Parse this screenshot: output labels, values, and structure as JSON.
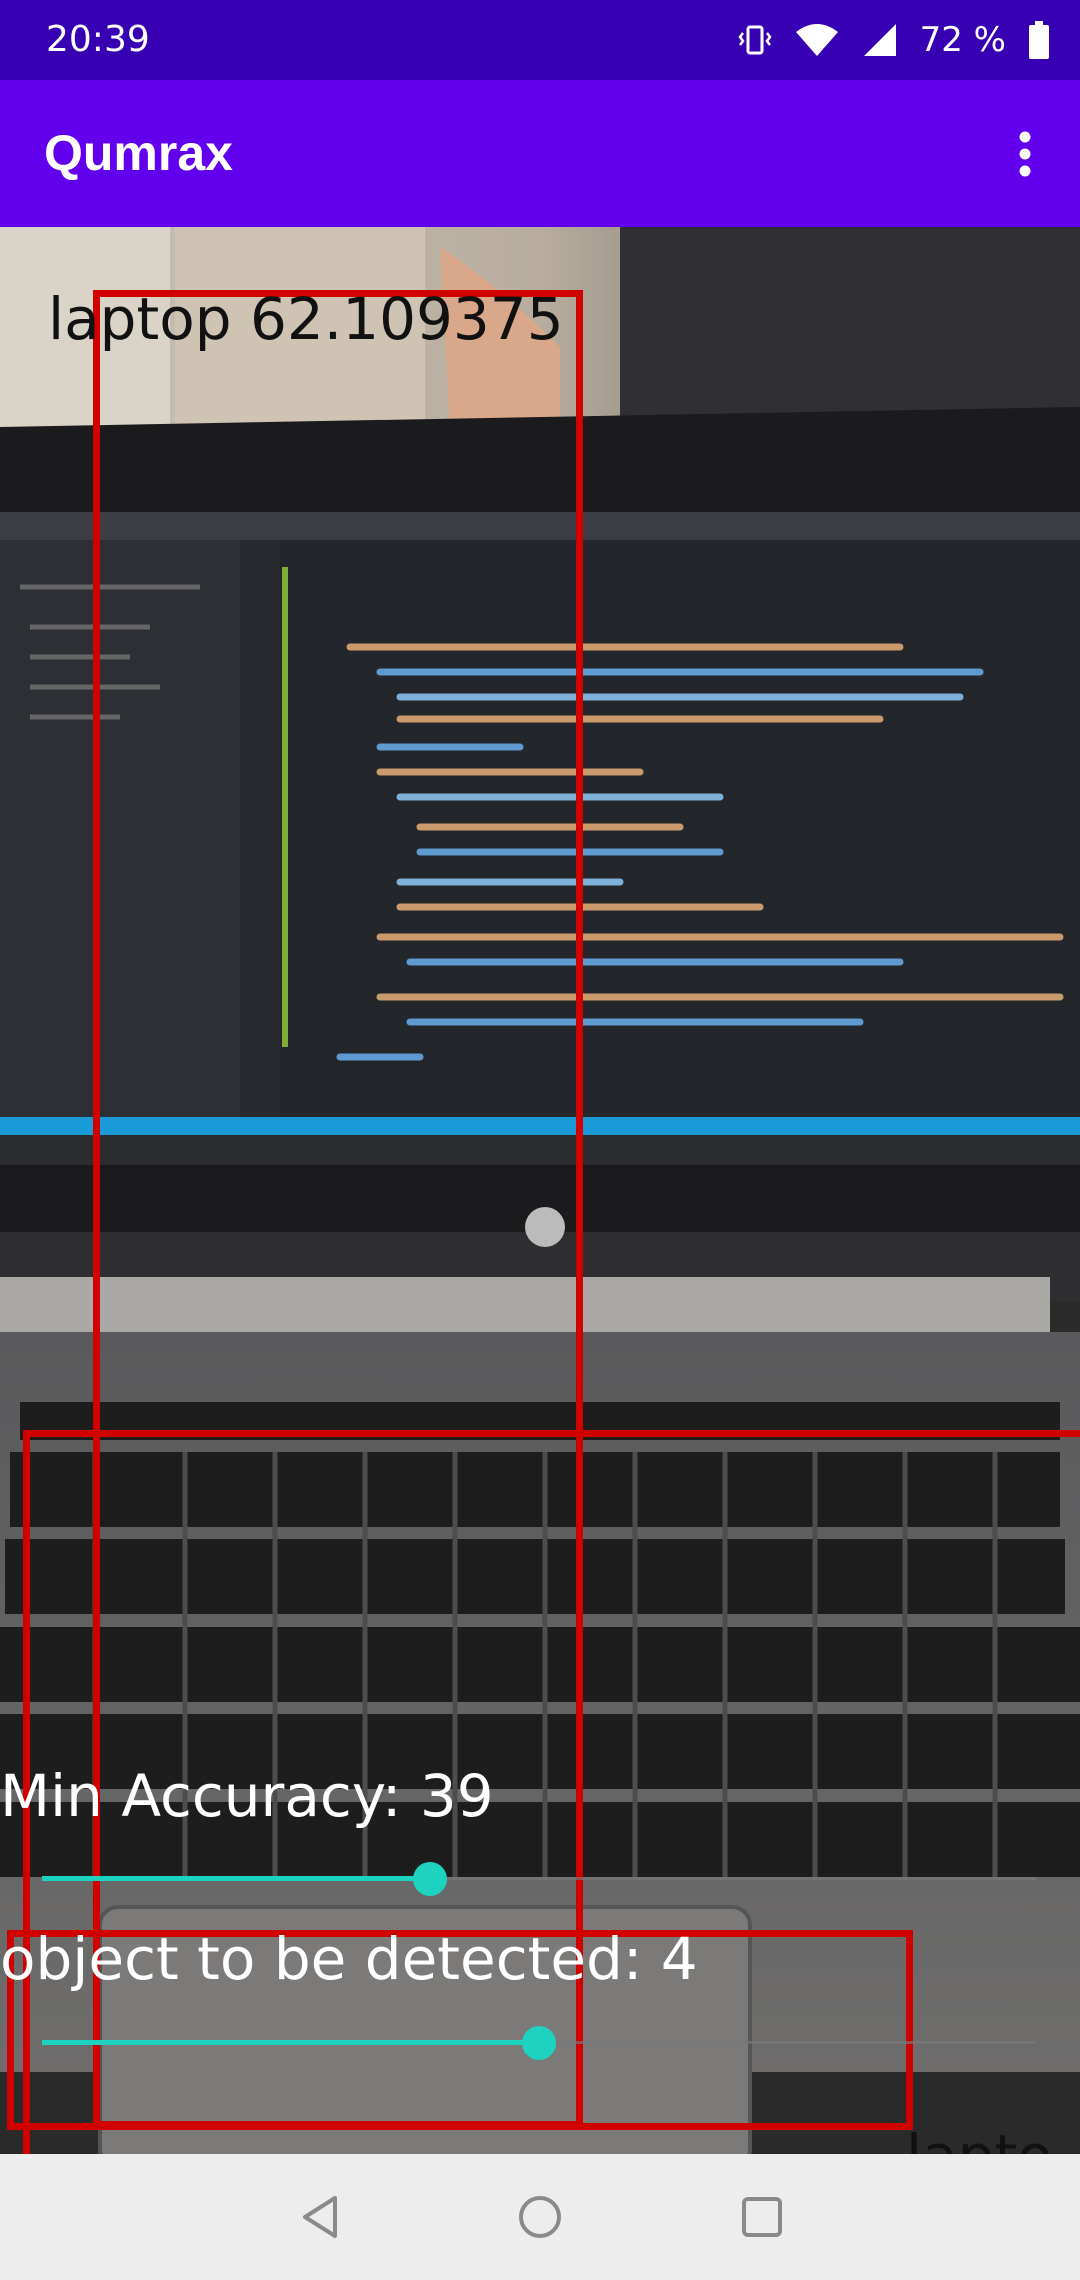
{
  "status_bar": {
    "time": "20:39",
    "battery_percent": "72 %",
    "icons": [
      "vibrate-icon",
      "wifi-icon",
      "signal-icon",
      "battery-icon"
    ]
  },
  "app_bar": {
    "title": "Qumrax",
    "menu_icon": "more-vert-icon"
  },
  "detections": [
    {
      "label": "laptop 62.109375"
    },
    {
      "label": ""
    },
    {
      "label": ""
    },
    {
      "label": "lapto"
    }
  ],
  "controls": {
    "min_accuracy": {
      "label": "Min Accuracy: 39",
      "value": 39,
      "max": 100
    },
    "objects": {
      "label": "object to be detected: 4",
      "value": 4,
      "max": 8
    }
  },
  "nav_bar": {
    "buttons": [
      "back-icon",
      "home-icon",
      "recents-icon"
    ]
  },
  "colors": {
    "status_bar": "#3700B3",
    "app_bar": "#6200EE",
    "box": "#D00000",
    "slider_accent": "#1DD3C0"
  }
}
